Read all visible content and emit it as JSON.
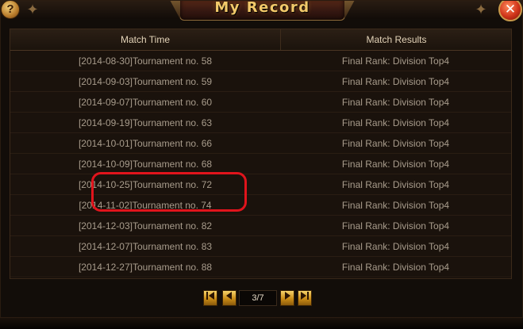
{
  "window": {
    "title": "My Record",
    "help_label": "?",
    "close_label": "✕",
    "ornament": "✦"
  },
  "table": {
    "headers": {
      "match_time": "Match Time",
      "match_results": "Match Results"
    },
    "rows": [
      {
        "time": "[2014-08-30]Tournament no. 58",
        "result": "Final Rank: Division Top4"
      },
      {
        "time": "[2014-09-03]Tournament no. 59",
        "result": "Final Rank: Division Top4"
      },
      {
        "time": "[2014-09-07]Tournament no. 60",
        "result": "Final Rank: Division Top4"
      },
      {
        "time": "[2014-09-19]Tournament no. 63",
        "result": "Final Rank: Division Top4"
      },
      {
        "time": "[2014-10-01]Tournament no. 66",
        "result": "Final Rank: Division Top4"
      },
      {
        "time": "[2014-10-09]Tournament no. 68",
        "result": "Final Rank: Division Top4"
      },
      {
        "time": "[2014-10-25]Tournament no. 72",
        "result": "Final Rank: Division Top4"
      },
      {
        "time": "[2014-11-02]Tournament no. 74",
        "result": "Final Rank: Division Top4"
      },
      {
        "time": "[2014-12-03]Tournament no. 82",
        "result": "Final Rank: Division Top4"
      },
      {
        "time": "[2014-12-07]Tournament no. 83",
        "result": "Final Rank: Division Top4"
      },
      {
        "time": "[2014-12-27]Tournament no. 88",
        "result": "Final Rank: Division Top4"
      }
    ]
  },
  "pagination": {
    "first_icon": "first-page-icon",
    "prev_icon": "previous-page-icon",
    "next_icon": "next-page-icon",
    "last_icon": "last-page-icon",
    "page_text": "3/7"
  },
  "colors": {
    "title": "#f2c96a",
    "annotation": "#e0141c",
    "row_text": "#a89c8c"
  }
}
